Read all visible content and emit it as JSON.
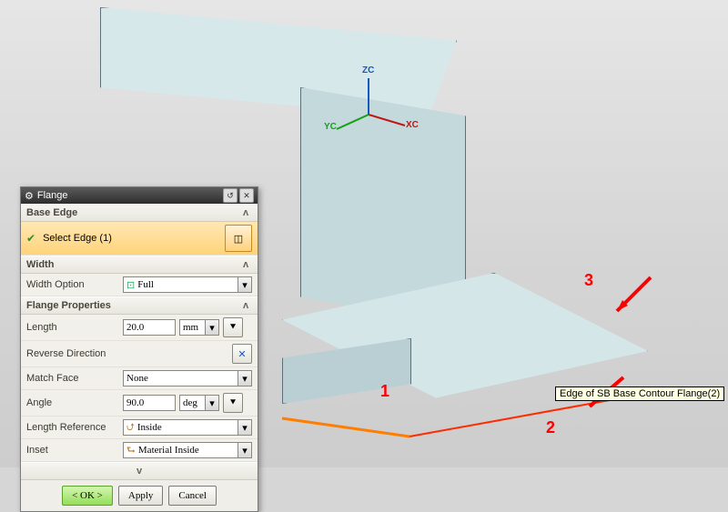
{
  "dialog": {
    "title": "Flange",
    "sections": {
      "base_edge": {
        "header": "Base Edge",
        "select_label": "Select Edge (1)"
      },
      "width": {
        "header": "Width",
        "option_label": "Width Option",
        "option_value": "Full"
      },
      "flange_props": {
        "header": "Flange Properties",
        "length_label": "Length",
        "length_value": "20.0",
        "length_unit": "mm",
        "reverse_label": "Reverse Direction",
        "match_face_label": "Match Face",
        "match_face_value": "None",
        "angle_label": "Angle",
        "angle_value": "90.0",
        "angle_unit": "deg",
        "length_ref_label": "Length Reference",
        "length_ref_value": "Inside",
        "inset_label": "Inset",
        "inset_value": "Material Inside"
      }
    },
    "buttons": {
      "ok": "< OK >",
      "apply": "Apply",
      "cancel": "Cancel"
    }
  },
  "annotations": {
    "one": "1",
    "two": "2",
    "three": "3"
  },
  "tooltip": "Edge of SB Base Contour Flange(2)",
  "triad": {
    "x": "XC",
    "y": "YC",
    "z": "ZC"
  },
  "icons": {
    "combo_full": "⊡",
    "len_ref": "⮍",
    "inset": "⮑",
    "reverse": "✕",
    "spin": "⯆",
    "cube": "◫"
  }
}
